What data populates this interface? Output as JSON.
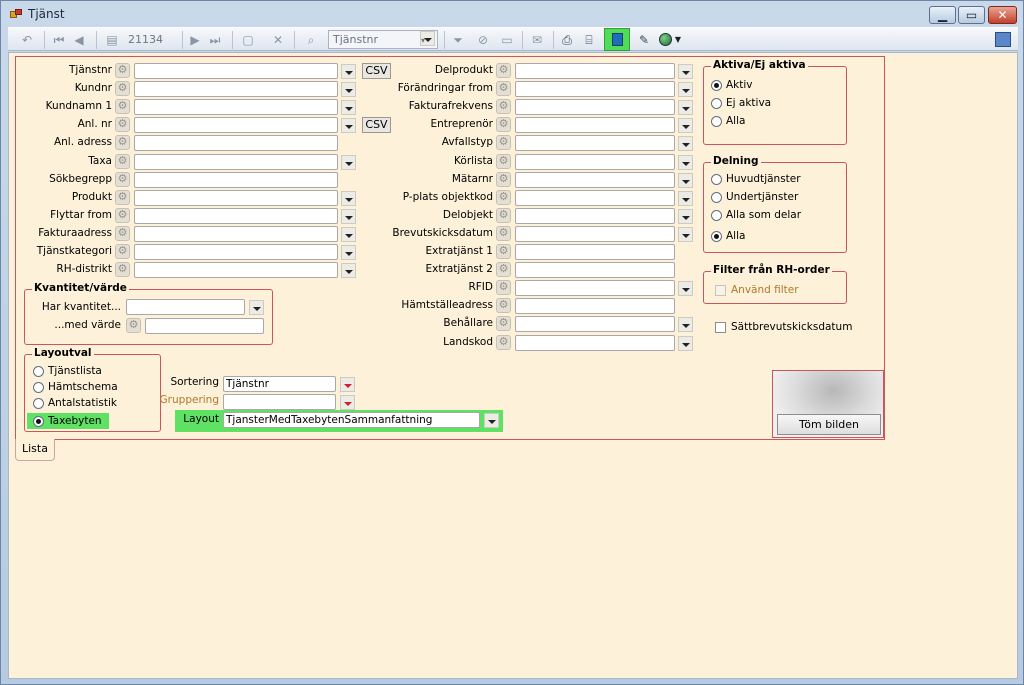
{
  "window": {
    "title": "Tjänst"
  },
  "toolbar": {
    "record_label": "21134 (0)",
    "search_field_value": "Tjänstnr"
  },
  "left_fields": [
    {
      "label": "Tjänstnr",
      "dropdown": true,
      "csv": "CSV"
    },
    {
      "label": "Kundnr",
      "dropdown": true
    },
    {
      "label": "Kundnamn 1",
      "dropdown": true
    },
    {
      "label": "Anl. nr",
      "dropdown": true,
      "csv": "CSV"
    },
    {
      "label": "Anl. adress",
      "dropdown": false
    },
    {
      "label": "Taxa",
      "dropdown": true
    },
    {
      "label": "Sökbegrepp",
      "dropdown": false
    },
    {
      "label": "Produkt",
      "dropdown": true
    },
    {
      "label": "Flyttar from",
      "dropdown": true
    },
    {
      "label": "Fakturaadress",
      "dropdown": true
    },
    {
      "label": "Tjänstkategori",
      "dropdown": true
    },
    {
      "label": "RH-distrikt",
      "dropdown": true
    }
  ],
  "right_fields": [
    {
      "label": "Delprodukt",
      "dropdown": true
    },
    {
      "label": "Förändringar from",
      "dropdown": true
    },
    {
      "label": "Fakturafrekvens",
      "dropdown": true
    },
    {
      "label": "Entreprenör",
      "dropdown": true
    },
    {
      "label": "Avfallstyp",
      "dropdown": true
    },
    {
      "label": "Körlista",
      "dropdown": true
    },
    {
      "label": "Mätarnr",
      "dropdown": true
    },
    {
      "label": "P-plats objektkod",
      "dropdown": true
    },
    {
      "label": "Delobjekt",
      "dropdown": true
    },
    {
      "label": "Brevutskicksdatum",
      "dropdown": true
    },
    {
      "label": "Extratjänst 1",
      "dropdown": false
    },
    {
      "label": "Extratjänst 2",
      "dropdown": false
    },
    {
      "label": "RFID",
      "dropdown": true
    },
    {
      "label": "Hämtställeadress",
      "dropdown": false
    },
    {
      "label": "Behållare",
      "dropdown": true
    },
    {
      "label": "Landskod",
      "dropdown": true
    }
  ],
  "kvantitet": {
    "title": "Kvantitet/värde",
    "har_label": "Har kvantitet...",
    "med_label": "...med värde"
  },
  "layoutval": {
    "title": "Layoutval",
    "options": [
      "Tjänstlista",
      "Hämtschema",
      "Antalstatistik",
      "Taxebyten"
    ],
    "selected": 3
  },
  "sorting": {
    "sortering_label": "Sortering",
    "sortering_value": "Tjänstnr",
    "gruppering_label": "Gruppering",
    "gruppering_value": "",
    "layout_label": "Layout",
    "layout_value": "TjansterMedTaxebytenSammanfattning"
  },
  "aktiva": {
    "title": "Aktiva/Ej aktiva",
    "options": [
      "Aktiv",
      "Ej aktiva",
      "Alla"
    ],
    "selected": 0
  },
  "delning": {
    "title": "Delning",
    "options": [
      "Huvudtjänster",
      "Undertjänster",
      "Alla som delar",
      "Alla"
    ],
    "selected": 3
  },
  "rh_filter": {
    "title": "Filter från RH-order",
    "checkbox_label": "Använd filter",
    "checked": false
  },
  "satt_brev": {
    "label": "Sättbrevutskicksdatum",
    "checked": false
  },
  "image_box": {
    "button_label": "Töm bilden"
  },
  "tabs": [
    {
      "label": "Lista"
    }
  ]
}
